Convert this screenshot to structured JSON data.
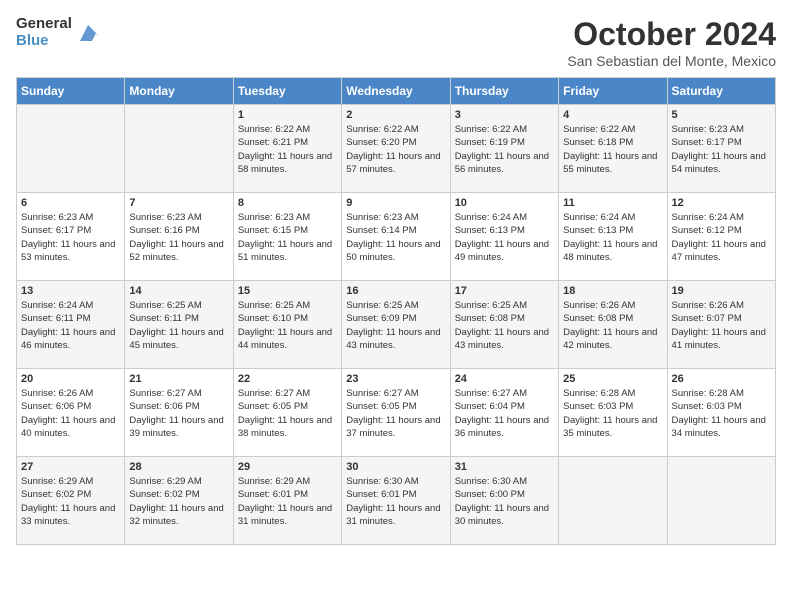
{
  "logo": {
    "general": "General",
    "blue": "Blue"
  },
  "title": "October 2024",
  "location": "San Sebastian del Monte, Mexico",
  "days_of_week": [
    "Sunday",
    "Monday",
    "Tuesday",
    "Wednesday",
    "Thursday",
    "Friday",
    "Saturday"
  ],
  "weeks": [
    [
      {
        "day": "",
        "sunrise": "",
        "sunset": "",
        "daylight": ""
      },
      {
        "day": "",
        "sunrise": "",
        "sunset": "",
        "daylight": ""
      },
      {
        "day": "1",
        "sunrise": "Sunrise: 6:22 AM",
        "sunset": "Sunset: 6:21 PM",
        "daylight": "Daylight: 11 hours and 58 minutes."
      },
      {
        "day": "2",
        "sunrise": "Sunrise: 6:22 AM",
        "sunset": "Sunset: 6:20 PM",
        "daylight": "Daylight: 11 hours and 57 minutes."
      },
      {
        "day": "3",
        "sunrise": "Sunrise: 6:22 AM",
        "sunset": "Sunset: 6:19 PM",
        "daylight": "Daylight: 11 hours and 56 minutes."
      },
      {
        "day": "4",
        "sunrise": "Sunrise: 6:22 AM",
        "sunset": "Sunset: 6:18 PM",
        "daylight": "Daylight: 11 hours and 55 minutes."
      },
      {
        "day": "5",
        "sunrise": "Sunrise: 6:23 AM",
        "sunset": "Sunset: 6:17 PM",
        "daylight": "Daylight: 11 hours and 54 minutes."
      }
    ],
    [
      {
        "day": "6",
        "sunrise": "Sunrise: 6:23 AM",
        "sunset": "Sunset: 6:17 PM",
        "daylight": "Daylight: 11 hours and 53 minutes."
      },
      {
        "day": "7",
        "sunrise": "Sunrise: 6:23 AM",
        "sunset": "Sunset: 6:16 PM",
        "daylight": "Daylight: 11 hours and 52 minutes."
      },
      {
        "day": "8",
        "sunrise": "Sunrise: 6:23 AM",
        "sunset": "Sunset: 6:15 PM",
        "daylight": "Daylight: 11 hours and 51 minutes."
      },
      {
        "day": "9",
        "sunrise": "Sunrise: 6:23 AM",
        "sunset": "Sunset: 6:14 PM",
        "daylight": "Daylight: 11 hours and 50 minutes."
      },
      {
        "day": "10",
        "sunrise": "Sunrise: 6:24 AM",
        "sunset": "Sunset: 6:13 PM",
        "daylight": "Daylight: 11 hours and 49 minutes."
      },
      {
        "day": "11",
        "sunrise": "Sunrise: 6:24 AM",
        "sunset": "Sunset: 6:13 PM",
        "daylight": "Daylight: 11 hours and 48 minutes."
      },
      {
        "day": "12",
        "sunrise": "Sunrise: 6:24 AM",
        "sunset": "Sunset: 6:12 PM",
        "daylight": "Daylight: 11 hours and 47 minutes."
      }
    ],
    [
      {
        "day": "13",
        "sunrise": "Sunrise: 6:24 AM",
        "sunset": "Sunset: 6:11 PM",
        "daylight": "Daylight: 11 hours and 46 minutes."
      },
      {
        "day": "14",
        "sunrise": "Sunrise: 6:25 AM",
        "sunset": "Sunset: 6:11 PM",
        "daylight": "Daylight: 11 hours and 45 minutes."
      },
      {
        "day": "15",
        "sunrise": "Sunrise: 6:25 AM",
        "sunset": "Sunset: 6:10 PM",
        "daylight": "Daylight: 11 hours and 44 minutes."
      },
      {
        "day": "16",
        "sunrise": "Sunrise: 6:25 AM",
        "sunset": "Sunset: 6:09 PM",
        "daylight": "Daylight: 11 hours and 43 minutes."
      },
      {
        "day": "17",
        "sunrise": "Sunrise: 6:25 AM",
        "sunset": "Sunset: 6:08 PM",
        "daylight": "Daylight: 11 hours and 43 minutes."
      },
      {
        "day": "18",
        "sunrise": "Sunrise: 6:26 AM",
        "sunset": "Sunset: 6:08 PM",
        "daylight": "Daylight: 11 hours and 42 minutes."
      },
      {
        "day": "19",
        "sunrise": "Sunrise: 6:26 AM",
        "sunset": "Sunset: 6:07 PM",
        "daylight": "Daylight: 11 hours and 41 minutes."
      }
    ],
    [
      {
        "day": "20",
        "sunrise": "Sunrise: 6:26 AM",
        "sunset": "Sunset: 6:06 PM",
        "daylight": "Daylight: 11 hours and 40 minutes."
      },
      {
        "day": "21",
        "sunrise": "Sunrise: 6:27 AM",
        "sunset": "Sunset: 6:06 PM",
        "daylight": "Daylight: 11 hours and 39 minutes."
      },
      {
        "day": "22",
        "sunrise": "Sunrise: 6:27 AM",
        "sunset": "Sunset: 6:05 PM",
        "daylight": "Daylight: 11 hours and 38 minutes."
      },
      {
        "day": "23",
        "sunrise": "Sunrise: 6:27 AM",
        "sunset": "Sunset: 6:05 PM",
        "daylight": "Daylight: 11 hours and 37 minutes."
      },
      {
        "day": "24",
        "sunrise": "Sunrise: 6:27 AM",
        "sunset": "Sunset: 6:04 PM",
        "daylight": "Daylight: 11 hours and 36 minutes."
      },
      {
        "day": "25",
        "sunrise": "Sunrise: 6:28 AM",
        "sunset": "Sunset: 6:03 PM",
        "daylight": "Daylight: 11 hours and 35 minutes."
      },
      {
        "day": "26",
        "sunrise": "Sunrise: 6:28 AM",
        "sunset": "Sunset: 6:03 PM",
        "daylight": "Daylight: 11 hours and 34 minutes."
      }
    ],
    [
      {
        "day": "27",
        "sunrise": "Sunrise: 6:29 AM",
        "sunset": "Sunset: 6:02 PM",
        "daylight": "Daylight: 11 hours and 33 minutes."
      },
      {
        "day": "28",
        "sunrise": "Sunrise: 6:29 AM",
        "sunset": "Sunset: 6:02 PM",
        "daylight": "Daylight: 11 hours and 32 minutes."
      },
      {
        "day": "29",
        "sunrise": "Sunrise: 6:29 AM",
        "sunset": "Sunset: 6:01 PM",
        "daylight": "Daylight: 11 hours and 31 minutes."
      },
      {
        "day": "30",
        "sunrise": "Sunrise: 6:30 AM",
        "sunset": "Sunset: 6:01 PM",
        "daylight": "Daylight: 11 hours and 31 minutes."
      },
      {
        "day": "31",
        "sunrise": "Sunrise: 6:30 AM",
        "sunset": "Sunset: 6:00 PM",
        "daylight": "Daylight: 11 hours and 30 minutes."
      },
      {
        "day": "",
        "sunrise": "",
        "sunset": "",
        "daylight": ""
      },
      {
        "day": "",
        "sunrise": "",
        "sunset": "",
        "daylight": ""
      }
    ]
  ]
}
